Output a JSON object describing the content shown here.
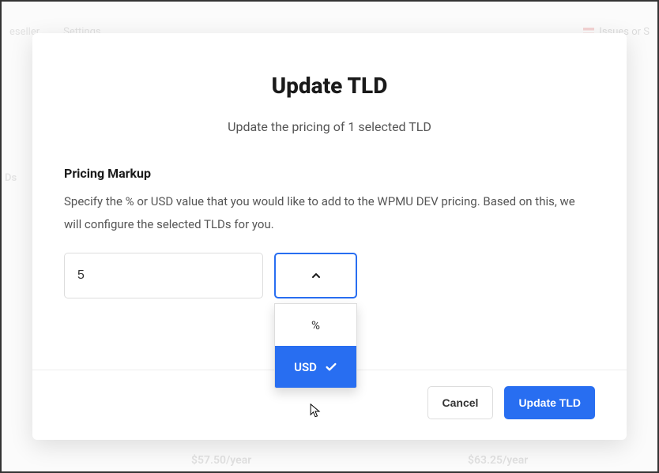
{
  "background": {
    "nav_items": [
      "eseller",
      "Settings"
    ],
    "nav_right": "Issues or S",
    "side_label": "Ds",
    "price_left": "$57.50/year",
    "price_right": "$63.25/year"
  },
  "modal": {
    "title": "Update TLD",
    "subtitle": "Update the pricing of 1 selected TLD",
    "section_label": "Pricing Markup",
    "help_text": "Specify the % or USD value that you would like to add to the WPMU DEV pricing. Based on this, we will configure the selected TLDs for you.",
    "markup_value": "5",
    "unit_options": {
      "percent": "%",
      "usd": "USD"
    },
    "selected_unit": "USD",
    "footer": {
      "cancel": "Cancel",
      "confirm": "Update TLD"
    }
  }
}
